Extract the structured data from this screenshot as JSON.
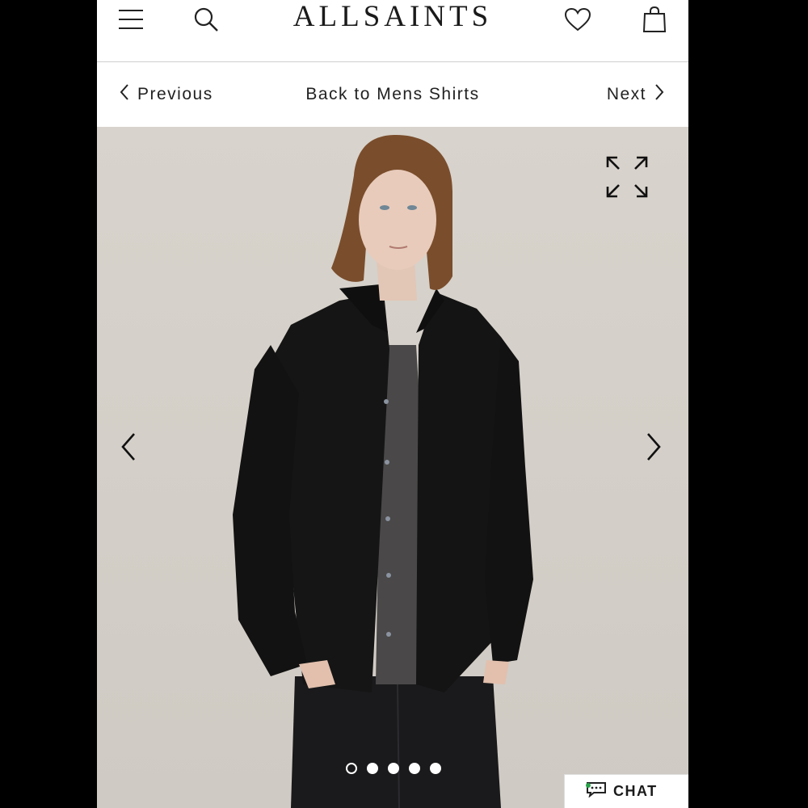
{
  "header": {
    "brand": "ALLSAINTS",
    "icons": [
      "menu-icon",
      "search-icon",
      "heart-icon",
      "bag-icon"
    ]
  },
  "nav": {
    "previous_label": "Previous",
    "back_label": "Back to Mens Shirts",
    "next_label": "Next"
  },
  "gallery": {
    "icons": [
      "expand-icon",
      "chevron-left-icon",
      "chevron-right-icon"
    ],
    "slide_count": 5,
    "active_slide": 1
  },
  "chat": {
    "label": "CHAT",
    "status_color": "#29a24a"
  },
  "colors": {
    "background_frame": "#000000",
    "image_backdrop": "#d6d1ca",
    "text": "#1a1a1a"
  }
}
